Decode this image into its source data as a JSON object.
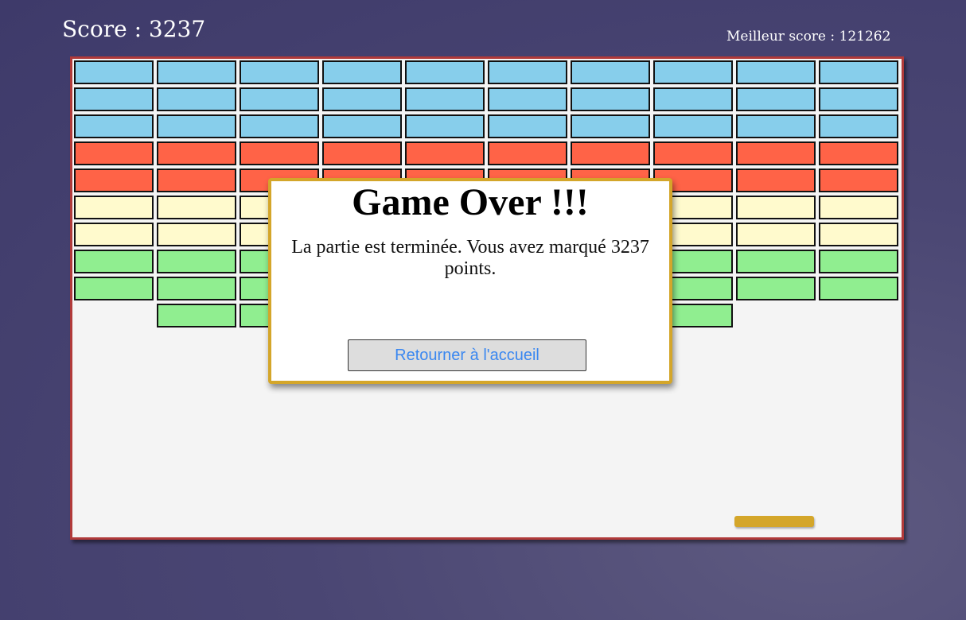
{
  "hud": {
    "score_text": "Score : 3237",
    "best_score_text": "Meilleur score : 121262"
  },
  "colors": {
    "background": "#46426f",
    "board_border": "#b03a3a",
    "board_fill": "#f4f4f4",
    "paddle": "#d4a62a",
    "modal_border": "#d4a62a",
    "button_text": "#3a87f0",
    "brick_rows": [
      "#87ceeb",
      "#87ceeb",
      "#87ceeb",
      "#ff6347",
      "#ff6347",
      "#fffacd",
      "#fffacd",
      "#90ee90",
      "#90ee90",
      "#90ee90"
    ]
  },
  "grid": {
    "columns": 10,
    "rows": 10,
    "remaining_bricks": [
      [
        1,
        1,
        1,
        1,
        1,
        1,
        1,
        1,
        1,
        1
      ],
      [
        1,
        1,
        1,
        1,
        1,
        1,
        1,
        1,
        1,
        1
      ],
      [
        1,
        1,
        1,
        1,
        1,
        1,
        1,
        1,
        1,
        1
      ],
      [
        1,
        1,
        1,
        1,
        1,
        1,
        1,
        1,
        1,
        1
      ],
      [
        1,
        1,
        1,
        1,
        1,
        1,
        1,
        1,
        1,
        1
      ],
      [
        1,
        1,
        1,
        1,
        1,
        1,
        1,
        1,
        1,
        1
      ],
      [
        1,
        1,
        1,
        1,
        1,
        1,
        1,
        1,
        1,
        1
      ],
      [
        1,
        1,
        1,
        1,
        1,
        1,
        1,
        1,
        1,
        1
      ],
      [
        1,
        1,
        1,
        1,
        1,
        1,
        1,
        1,
        1,
        1
      ],
      [
        0,
        1,
        1,
        1,
        1,
        1,
        1,
        1,
        0,
        0
      ]
    ]
  },
  "modal": {
    "title": "Game Over !!!",
    "message": "La partie est terminée. Vous avez marqué 3237 points.",
    "button_label": "Retourner à l'accueil"
  }
}
